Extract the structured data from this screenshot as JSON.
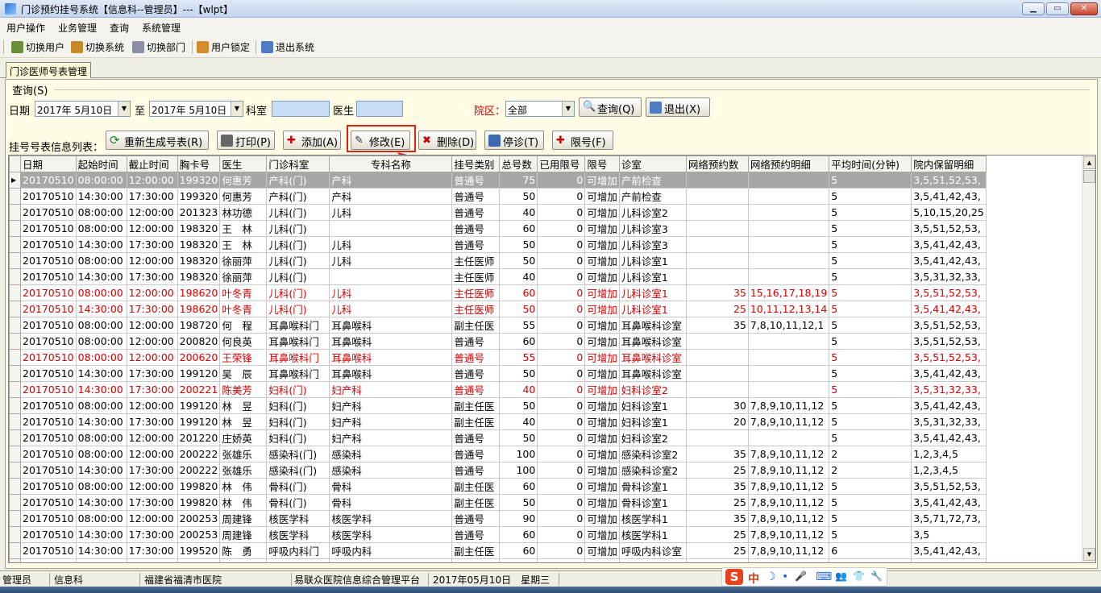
{
  "window": {
    "title": "门诊预约挂号系统【信息科--管理员】---【wlpt】",
    "min": "▁",
    "max": "▭",
    "close": "✕"
  },
  "menu": [
    "用户操作",
    "业务管理",
    "查询",
    "系统管理"
  ],
  "toolbar": [
    "切换用户",
    "切换系统",
    "切换部门",
    "用户锁定",
    "退出系统"
  ],
  "tab": "门诊医师号表管理",
  "query": {
    "group_label": "查询(S)",
    "date_label": "日期",
    "date_from": "2017年 5月10日",
    "to_label": "至",
    "date_to": "2017年 5月10日",
    "dept_label": "科室",
    "doctor_label": "医生",
    "campus_label": "院区：",
    "campus_value": "全部",
    "search_btn": "查询(Q)",
    "exit_btn": "退出(X)"
  },
  "list": {
    "label": "挂号号表信息列表：",
    "buttons": [
      "重新生成号表(R)",
      "打印(P)",
      "添加(A)",
      "修改(E)",
      "删除(D)",
      "停诊(T)",
      "限号(F)"
    ]
  },
  "table": {
    "columns": [
      "日期",
      "起始时间",
      "截止时间",
      "胸卡号",
      "医生",
      "门诊科室",
      "专科名称",
      "挂号类别",
      "总号数",
      "已用限号",
      "限号",
      "诊室",
      "网络预约数",
      "网络预约明细",
      "平均时间(分钟)",
      "院内保留明细"
    ],
    "rows": [
      [
        "20170510",
        "08:00:00",
        "12:00:00",
        "199320",
        "何惠芳",
        "产科(门)",
        "产科",
        "普通号",
        "75",
        "0",
        "可增加",
        "产前检查",
        "",
        "",
        "5",
        "3,5,51,52,53,"
      ],
      [
        "20170510",
        "14:30:00",
        "17:30:00",
        "199320",
        "何惠芳",
        "产科(门)",
        "产科",
        "普通号",
        "50",
        "0",
        "可增加",
        "产前检查",
        "",
        "",
        "5",
        "3,5,41,42,43,"
      ],
      [
        "20170510",
        "08:00:00",
        "12:00:00",
        "201323",
        "林功德",
        "儿科(门)",
        "儿科",
        "普通号",
        "40",
        "0",
        "可增加",
        "儿科诊室2",
        "",
        "",
        "5",
        "5,10,15,20,25"
      ],
      [
        "20170510",
        "08:00:00",
        "12:00:00",
        "198320",
        "王　林",
        "儿科(门)",
        "",
        "普通号",
        "60",
        "0",
        "可增加",
        "儿科诊室3",
        "",
        "",
        "5",
        "3,5,51,52,53,"
      ],
      [
        "20170510",
        "14:30:00",
        "17:30:00",
        "198320",
        "王　林",
        "儿科(门)",
        "儿科",
        "普通号",
        "50",
        "0",
        "可增加",
        "儿科诊室3",
        "",
        "",
        "5",
        "3,5,41,42,43,"
      ],
      [
        "20170510",
        "08:00:00",
        "12:00:00",
        "198320",
        "徐丽萍",
        "儿科(门)",
        "儿科",
        "主任医师",
        "50",
        "0",
        "可增加",
        "儿科诊室1",
        "",
        "",
        "5",
        "3,5,41,42,43,"
      ],
      [
        "20170510",
        "14:30:00",
        "17:30:00",
        "198320",
        "徐丽萍",
        "儿科(门)",
        "",
        "主任医师",
        "40",
        "0",
        "可增加",
        "儿科诊室1",
        "",
        "",
        "5",
        "3,5,31,32,33,"
      ],
      [
        "20170510",
        "08:00:00",
        "12:00:00",
        "198620",
        "叶冬青",
        "儿科(门)",
        "儿科",
        "主任医师",
        "60",
        "0",
        "可增加",
        "儿科诊室1",
        "35",
        "15,16,17,18,19",
        "5",
        "3,5,51,52,53,"
      ],
      [
        "20170510",
        "14:30:00",
        "17:30:00",
        "198620",
        "叶冬青",
        "儿科(门)",
        "儿科",
        "主任医师",
        "50",
        "0",
        "可增加",
        "儿科诊室1",
        "25",
        "10,11,12,13,14",
        "5",
        "3,5,41,42,43,"
      ],
      [
        "20170510",
        "08:00:00",
        "12:00:00",
        "198720",
        "何　程",
        "耳鼻喉科门",
        "耳鼻喉科",
        "副主任医",
        "55",
        "0",
        "可增加",
        "耳鼻喉科诊室",
        "35",
        "7,8,10,11,12,1",
        "5",
        "3,5,51,52,53,"
      ],
      [
        "20170510",
        "08:00:00",
        "12:00:00",
        "200820",
        "何良英",
        "耳鼻喉科门",
        "耳鼻喉科",
        "普通号",
        "60",
        "0",
        "可增加",
        "耳鼻喉科诊室",
        "",
        "",
        "5",
        "3,5,51,52,53,"
      ],
      [
        "20170510",
        "08:00:00",
        "12:00:00",
        "200620",
        "王荣锋",
        "耳鼻喉科门",
        "耳鼻喉科",
        "普通号",
        "55",
        "0",
        "可增加",
        "耳鼻喉科诊室",
        "",
        "",
        "5",
        "3,5,51,52,53,"
      ],
      [
        "20170510",
        "14:30:00",
        "17:30:00",
        "199120",
        "吴　辰",
        "耳鼻喉科门",
        "耳鼻喉科",
        "普通号",
        "50",
        "0",
        "可增加",
        "耳鼻喉科诊室",
        "",
        "",
        "5",
        "3,5,41,42,43,"
      ],
      [
        "20170510",
        "14:30:00",
        "17:30:00",
        "200221",
        "陈美芳",
        "妇科(门)",
        "妇产科",
        "普通号",
        "40",
        "0",
        "可增加",
        "妇科诊室2",
        "",
        "",
        "5",
        "3,5,31,32,33,"
      ],
      [
        "20170510",
        "08:00:00",
        "12:00:00",
        "199120",
        "林　昱",
        "妇科(门)",
        "妇产科",
        "副主任医",
        "50",
        "0",
        "可增加",
        "妇科诊室1",
        "30",
        "7,8,9,10,11,12",
        "5",
        "3,5,41,42,43,"
      ],
      [
        "20170510",
        "14:30:00",
        "17:30:00",
        "199120",
        "林　昱",
        "妇科(门)",
        "妇产科",
        "副主任医",
        "40",
        "0",
        "可增加",
        "妇科诊室1",
        "20",
        "7,8,9,10,11,12",
        "5",
        "3,5,31,32,33,"
      ],
      [
        "20170510",
        "08:00:00",
        "12:00:00",
        "201220",
        "庄娇英",
        "妇科(门)",
        "妇产科",
        "普通号",
        "50",
        "0",
        "可增加",
        "妇科诊室2",
        "",
        "",
        "5",
        "3,5,41,42,43,"
      ],
      [
        "20170510",
        "08:00:00",
        "12:00:00",
        "200222",
        "张雄乐",
        "感染科(门)",
        "感染科",
        "普通号",
        "100",
        "0",
        "可增加",
        "感染科诊室2",
        "35",
        "7,8,9,10,11,12",
        "2",
        "1,2,3,4,5"
      ],
      [
        "20170510",
        "14:30:00",
        "17:30:00",
        "200222",
        "张雄乐",
        "感染科(门)",
        "感染科",
        "普通号",
        "100",
        "0",
        "可增加",
        "感染科诊室2",
        "25",
        "7,8,9,10,11,12",
        "2",
        "1,2,3,4,5"
      ],
      [
        "20170510",
        "08:00:00",
        "12:00:00",
        "199820",
        "林　伟",
        "骨科(门)",
        "骨科",
        "副主任医",
        "60",
        "0",
        "可增加",
        "骨科诊室1",
        "35",
        "7,8,9,10,11,12",
        "5",
        "3,5,51,52,53,"
      ],
      [
        "20170510",
        "14:30:00",
        "17:30:00",
        "199820",
        "林　伟",
        "骨科(门)",
        "骨科",
        "副主任医",
        "50",
        "0",
        "可增加",
        "骨科诊室1",
        "25",
        "7,8,9,10,11,12",
        "5",
        "3,5,41,42,43,"
      ],
      [
        "20170510",
        "08:00:00",
        "12:00:00",
        "200253",
        "周建锋",
        "核医学科",
        "核医学科",
        "普通号",
        "90",
        "0",
        "可增加",
        "核医学科1",
        "35",
        "7,8,9,10,11,12",
        "5",
        "3,5,71,72,73,"
      ],
      [
        "20170510",
        "14:30:00",
        "17:30:00",
        "200253",
        "周建锋",
        "核医学科",
        "核医学科",
        "普通号",
        "60",
        "0",
        "可增加",
        "核医学科1",
        "25",
        "7,8,9,10,11,12",
        "5",
        "3,5"
      ],
      [
        "20170510",
        "14:30:00",
        "17:30:00",
        "199520",
        "陈　勇",
        "呼吸内科门",
        "呼吸内科",
        "副主任医",
        "60",
        "0",
        "可增加",
        "呼吸内科诊室",
        "25",
        "7,8,9,10,11,12",
        "6",
        "3,5,41,42,43,"
      ],
      [
        "20170510",
        "14:30:00",
        "17:30:00",
        "196820",
        "陈茂祥",
        "急诊科",
        "普通内科",
        "副主任医",
        "60",
        "0",
        "可增加",
        "普通内科诊室",
        "25",
        "7,8,9,10,11,12",
        "4",
        "3,5,41,42,43,"
      ]
    ],
    "selected_row": 0,
    "red_rows": [
      7,
      8,
      11,
      13
    ],
    "row_indicator": "▶"
  },
  "status": [
    "管理员",
    "信息科",
    "福建省福清市医院",
    "易联众医院信息综合管理平台",
    "2017年05月10日　星期三"
  ],
  "ime": [
    "S",
    "中",
    "☽",
    "•",
    "🎤",
    "⌨",
    "👥",
    "👕",
    "🔧"
  ]
}
